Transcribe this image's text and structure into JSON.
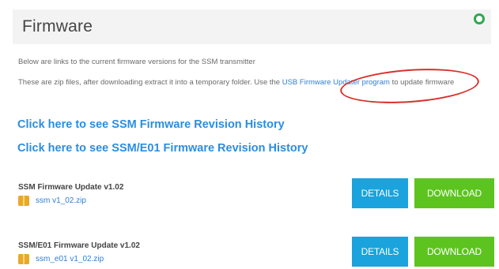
{
  "panel": {
    "title": "Firmware"
  },
  "intro": {
    "line1": "Below are links to the current firmware versions for the SSM transmitter",
    "line2_before": "These are zip files, after downloading extract it into a temporary folder. Use the ",
    "line2_link": "USB Firmware Updater program",
    "line2_after": " to update firmware"
  },
  "history_links": [
    "Click here to see SSM Firmware Revision History",
    "Click here to see SSM/E01 Firmware Revision History"
  ],
  "firmware_items": [
    {
      "title": "SSM Firmware Update v1.02",
      "file": "ssm v1_02.zip",
      "details_label": "DETAILS",
      "download_label": "DOWNLOAD"
    },
    {
      "title": "SSM/E01 Firmware Update v1.02",
      "file": "ssm_e01 v1_02.zip",
      "details_label": "DETAILS",
      "download_label": "DOWNLOAD"
    }
  ],
  "colors": {
    "link": "#2f7fd1",
    "details_button": "#1aa3dc",
    "download_button": "#5dc41f",
    "highlight_circle": "#d9302b"
  }
}
